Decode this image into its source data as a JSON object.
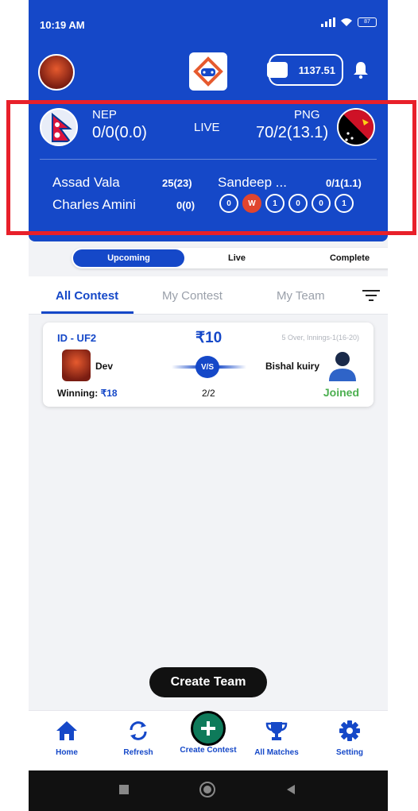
{
  "status": {
    "time": "10:19 AM",
    "battery": "87"
  },
  "header": {
    "wallet_amount": "1137.51",
    "team1": {
      "code": "NEP",
      "score": "0/0(0.0)"
    },
    "team2": {
      "code": "PNG",
      "score": "70/2(13.1)"
    },
    "status": "LIVE",
    "batsmen": [
      {
        "name": "Assad Vala",
        "stat": "25(23)"
      },
      {
        "name": "Charles Amini",
        "stat": "0(0)"
      }
    ],
    "bowler": {
      "name": "Sandeep ...",
      "stat": "0/1(1.1)"
    },
    "recent_balls": [
      "0",
      "W",
      "1",
      "0",
      "0",
      "1"
    ]
  },
  "match_tabs": [
    "Upcoming",
    "Live",
    "Complete"
  ],
  "contest_tabs": [
    "All Contest",
    "My Contest",
    "My Team"
  ],
  "contest": {
    "id": "ID - UF2",
    "prize": "₹10",
    "info": "5 Over, Innings-1(16-20)",
    "user1": "Dev",
    "user2": "Bishal kuiry",
    "vs": "V/S",
    "winning_label": "Winning:",
    "winning_value": "₹18",
    "slots": "2/2",
    "status": "Joined"
  },
  "create_team_label": "Create Team",
  "bottom_nav": {
    "home": "Home",
    "refresh": "Refresh",
    "create_contest": "Create Contest",
    "all_matches": "All Matches",
    "setting": "Setting"
  },
  "colors": {
    "primary": "#1548c8",
    "accent_red": "#e8202a",
    "success": "#4caf50"
  }
}
